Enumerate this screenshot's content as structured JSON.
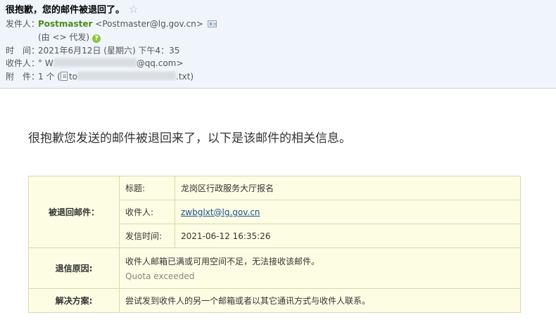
{
  "header": {
    "subject": "很抱歉，您的邮件被退回了。",
    "star_glyph": "☆",
    "from": {
      "label": "发件人：",
      "name": "Postmaster",
      "address": "<Postmaster@lg.gov.cn>",
      "via": "(由 <> 代发)"
    },
    "time": {
      "label": "时　间：",
      "value": "2021年6月12日 (星期六) 下午4：35"
    },
    "to": {
      "label": "收件人：",
      "prefix": "° W",
      "suffix": "@qq.com>"
    },
    "attachment": {
      "label": "附　件：",
      "count": "1 个 (",
      "name_prefix": "to",
      "name_suffix": ".txt)"
    }
  },
  "intro": "很抱歉您发送的邮件被退回来了，以下是该邮件的相关信息。",
  "bounce": {
    "returned_label": "被退回邮件：",
    "subject_label": "标题:",
    "subject_value": "龙岗区行政服务大厅报名",
    "recipient_label": "收件人:",
    "recipient_value": "zwbglxt@lg.gov.cn",
    "sent_label": "发信时间:",
    "sent_value": "2021-06-12 16:35:26",
    "reason_label": "退信原因:",
    "reason_cn": "收件人邮箱已满或可用空间不足，无法接收该邮件。",
    "reason_en": "Quota exceeded",
    "solution_label": "解决方案:",
    "solution_value": "尝试发到收件人的另一个邮箱或者以其它通讯方式与收件人联系。"
  }
}
